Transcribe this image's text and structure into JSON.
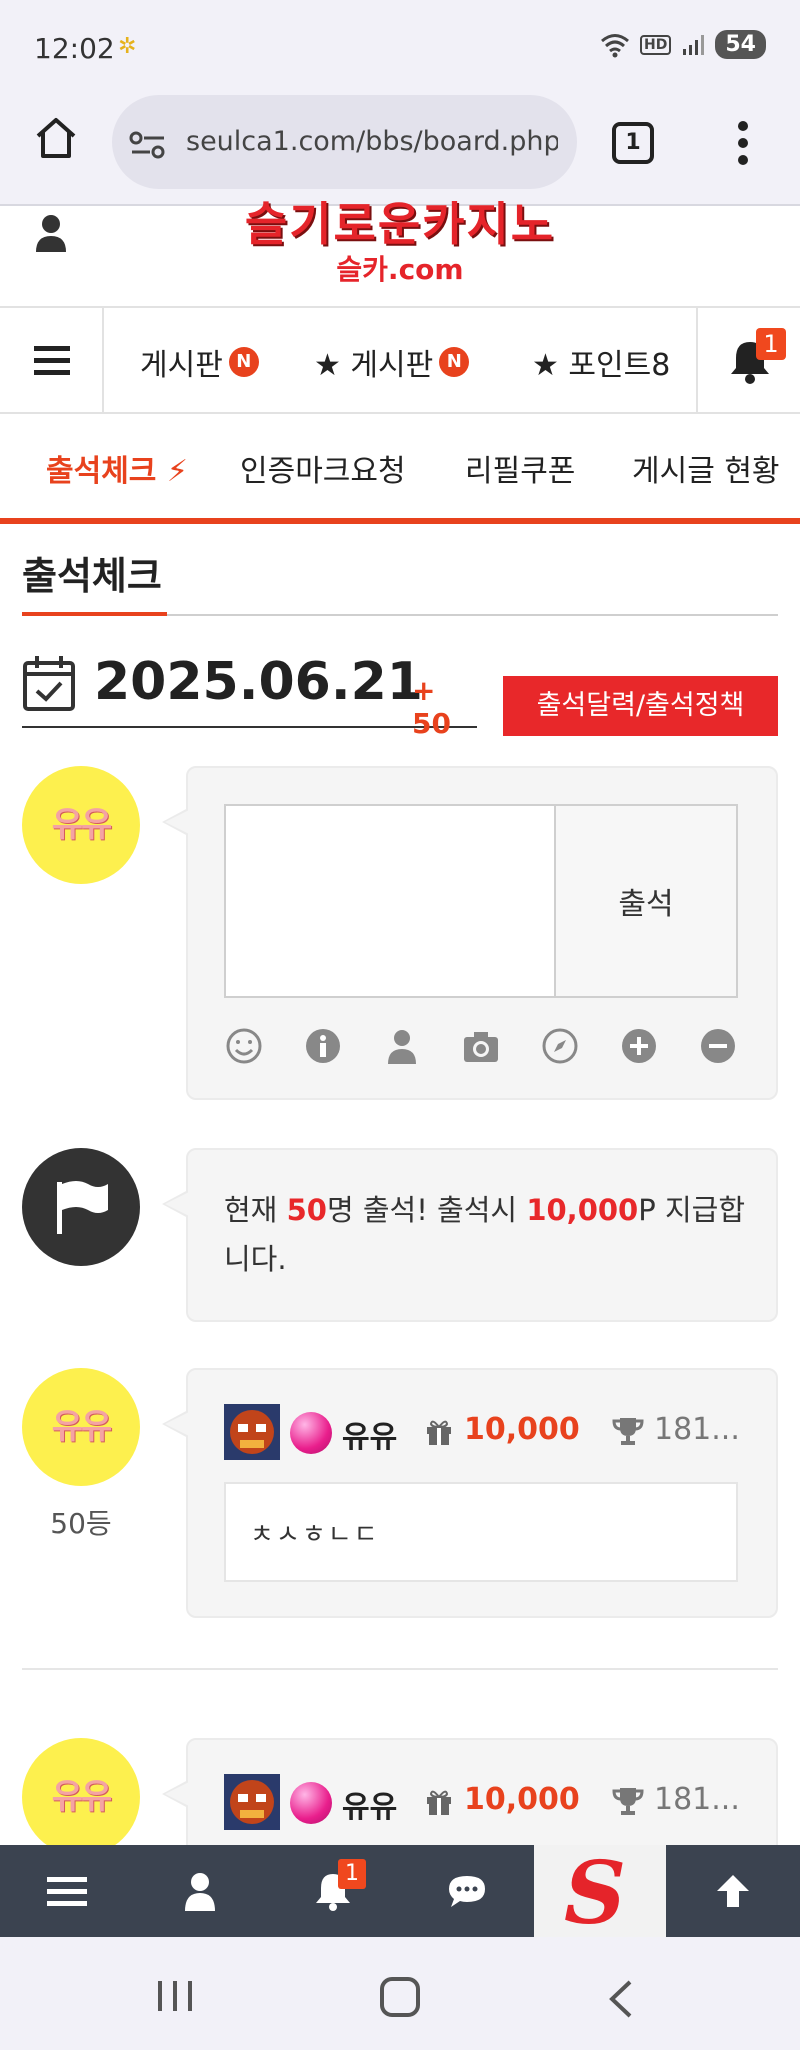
{
  "status_bar": {
    "time": "12:02",
    "network": "HD",
    "battery": "54"
  },
  "browser": {
    "url": "seulca1.com/bbs/board.php",
    "tab_count": "1"
  },
  "site": {
    "logo_text": "슬기로운카지노",
    "logo_sub": "슬카.com"
  },
  "nav_primary": {
    "items": [
      {
        "label": "게시판",
        "badge": "N"
      },
      {
        "label": "★ 게시판",
        "badge": "N"
      },
      {
        "label": "★ 포인트8"
      }
    ],
    "notification_count": "1"
  },
  "nav_secondary": {
    "items": [
      {
        "label": "출석체크 ⚡",
        "active": true
      },
      {
        "label": "인증마크요청"
      },
      {
        "label": "리필쿠폰"
      },
      {
        "label": "게시글 현황"
      }
    ]
  },
  "page": {
    "title": "출석체크",
    "date": "2025.06.21",
    "date_points": "+ 50",
    "policy_button": "출석달력/출석정책"
  },
  "comment_form": {
    "avatar_text": "유유",
    "submit_label": "출석",
    "tools": [
      "smile-icon",
      "info-icon",
      "user-icon",
      "camera-icon",
      "compass-icon",
      "plus-icon",
      "minus-icon"
    ]
  },
  "notice": {
    "prefix": "현재 ",
    "count": "50",
    "middle": "명 출석! 출석시 ",
    "points": "10,000",
    "suffix": "P 지급합니다."
  },
  "entries": [
    {
      "avatar_text": "유유",
      "rank": "50등",
      "name": "유유",
      "points": "10,000",
      "trophy": "181...",
      "message": "ㅊㅅㅎㄴㄷ"
    },
    {
      "avatar_text": "유유",
      "name": "유유",
      "points": "10,000",
      "trophy": "181..."
    }
  ],
  "bottom_nav": {
    "notification_count": "1",
    "logo_letter": "S"
  },
  "colors": {
    "accent": "#e8421d",
    "red_button": "#e8282a",
    "bottom_nav_bg": "#3b4350",
    "avatar_yellow": "#fdf04e"
  }
}
